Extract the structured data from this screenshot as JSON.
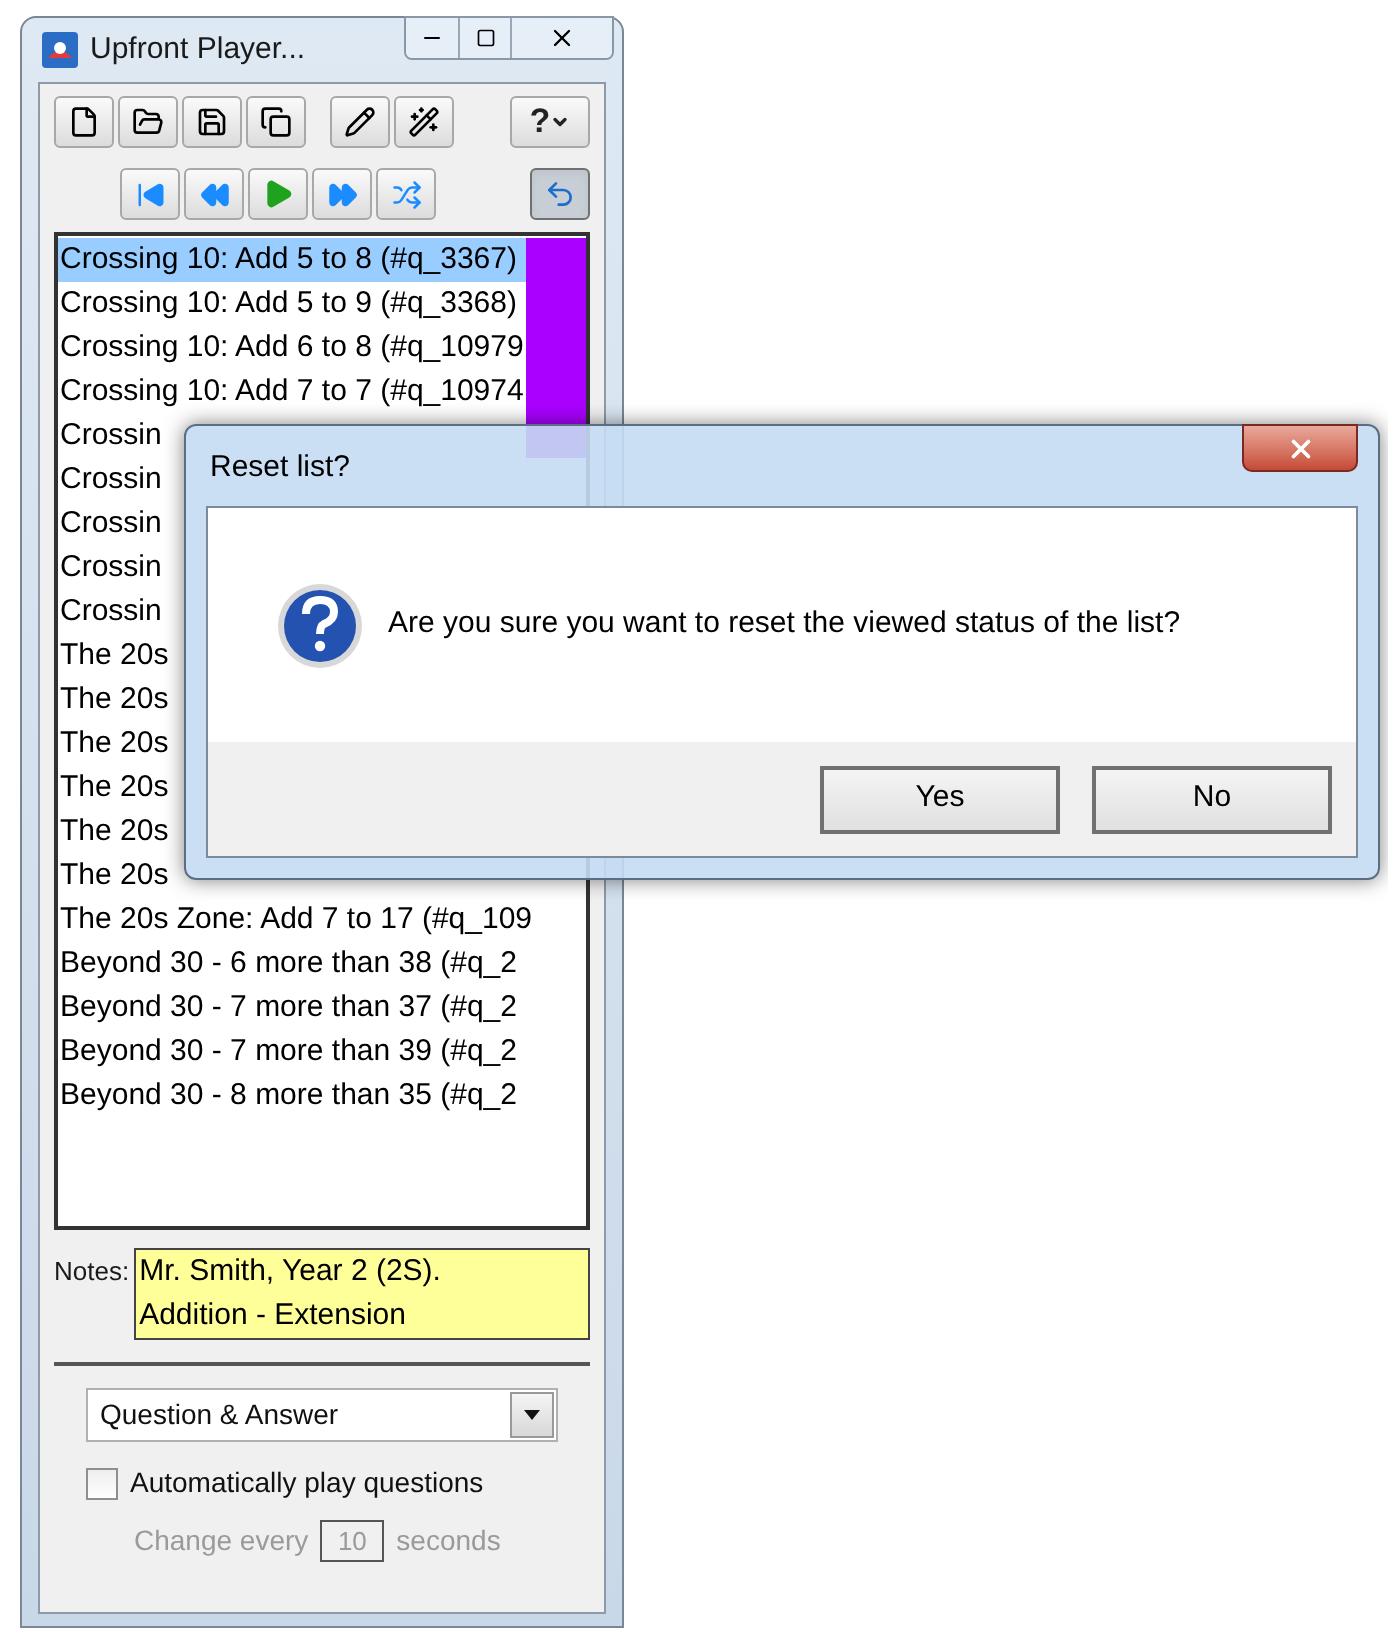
{
  "window": {
    "title": "Upfront Player..."
  },
  "help_button": {
    "label": "?"
  },
  "repeat_toggle": {
    "pressed": true
  },
  "list": {
    "items": [
      {
        "text": "Crossing 10: Add 5 to 8 (#q_3367)",
        "selected": true,
        "viewed": true
      },
      {
        "text": "Crossing 10: Add 5 to 9 (#q_3368)",
        "selected": false,
        "viewed": true
      },
      {
        "text": "Crossing 10: Add 6 to 8 (#q_10979",
        "selected": false,
        "viewed": true
      },
      {
        "text": "Crossing 10: Add 7 to 7 (#q_10974",
        "selected": false,
        "viewed": true
      },
      {
        "text": "Crossin",
        "selected": false,
        "viewed": true
      },
      {
        "text": "Crossin",
        "selected": false
      },
      {
        "text": "Crossin",
        "selected": false
      },
      {
        "text": "Crossin",
        "selected": false
      },
      {
        "text": "Crossin",
        "selected": false
      },
      {
        "text": "The 20s",
        "selected": false
      },
      {
        "text": "The 20s",
        "selected": false
      },
      {
        "text": "The 20s",
        "selected": false
      },
      {
        "text": "The 20s",
        "selected": false
      },
      {
        "text": "The 20s",
        "selected": false
      },
      {
        "text": "The 20s",
        "selected": false
      },
      {
        "text": "The 20s Zone: Add 7 to 17 (#q_109",
        "selected": false,
        "viewed": false
      },
      {
        "text": "Beyond 30 - 6 more than 38 (#q_2",
        "selected": false,
        "viewed": false
      },
      {
        "text": "Beyond 30 - 7 more than 37 (#q_2",
        "selected": false,
        "viewed": false
      },
      {
        "text": "Beyond 30 - 7 more than 39 (#q_2",
        "selected": false,
        "viewed": false
      },
      {
        "text": "Beyond 30 - 8 more than 35 (#q_2",
        "selected": false,
        "viewed": false
      }
    ]
  },
  "notes": {
    "label": "Notes:",
    "lines": [
      "Mr. Smith, Year 2 (2S).",
      "Addition - Extension"
    ]
  },
  "mode_select": {
    "value": "Question & Answer"
  },
  "autoplay": {
    "label": "Automatically play questions",
    "checked": false
  },
  "interval": {
    "prefix": "Change every",
    "value": "10",
    "suffix": "seconds",
    "disabled": true
  },
  "dialog": {
    "title": "Reset list?",
    "message": "Are you sure you want to reset the viewed status of the list?",
    "buttons": [
      "Yes",
      "No"
    ]
  }
}
